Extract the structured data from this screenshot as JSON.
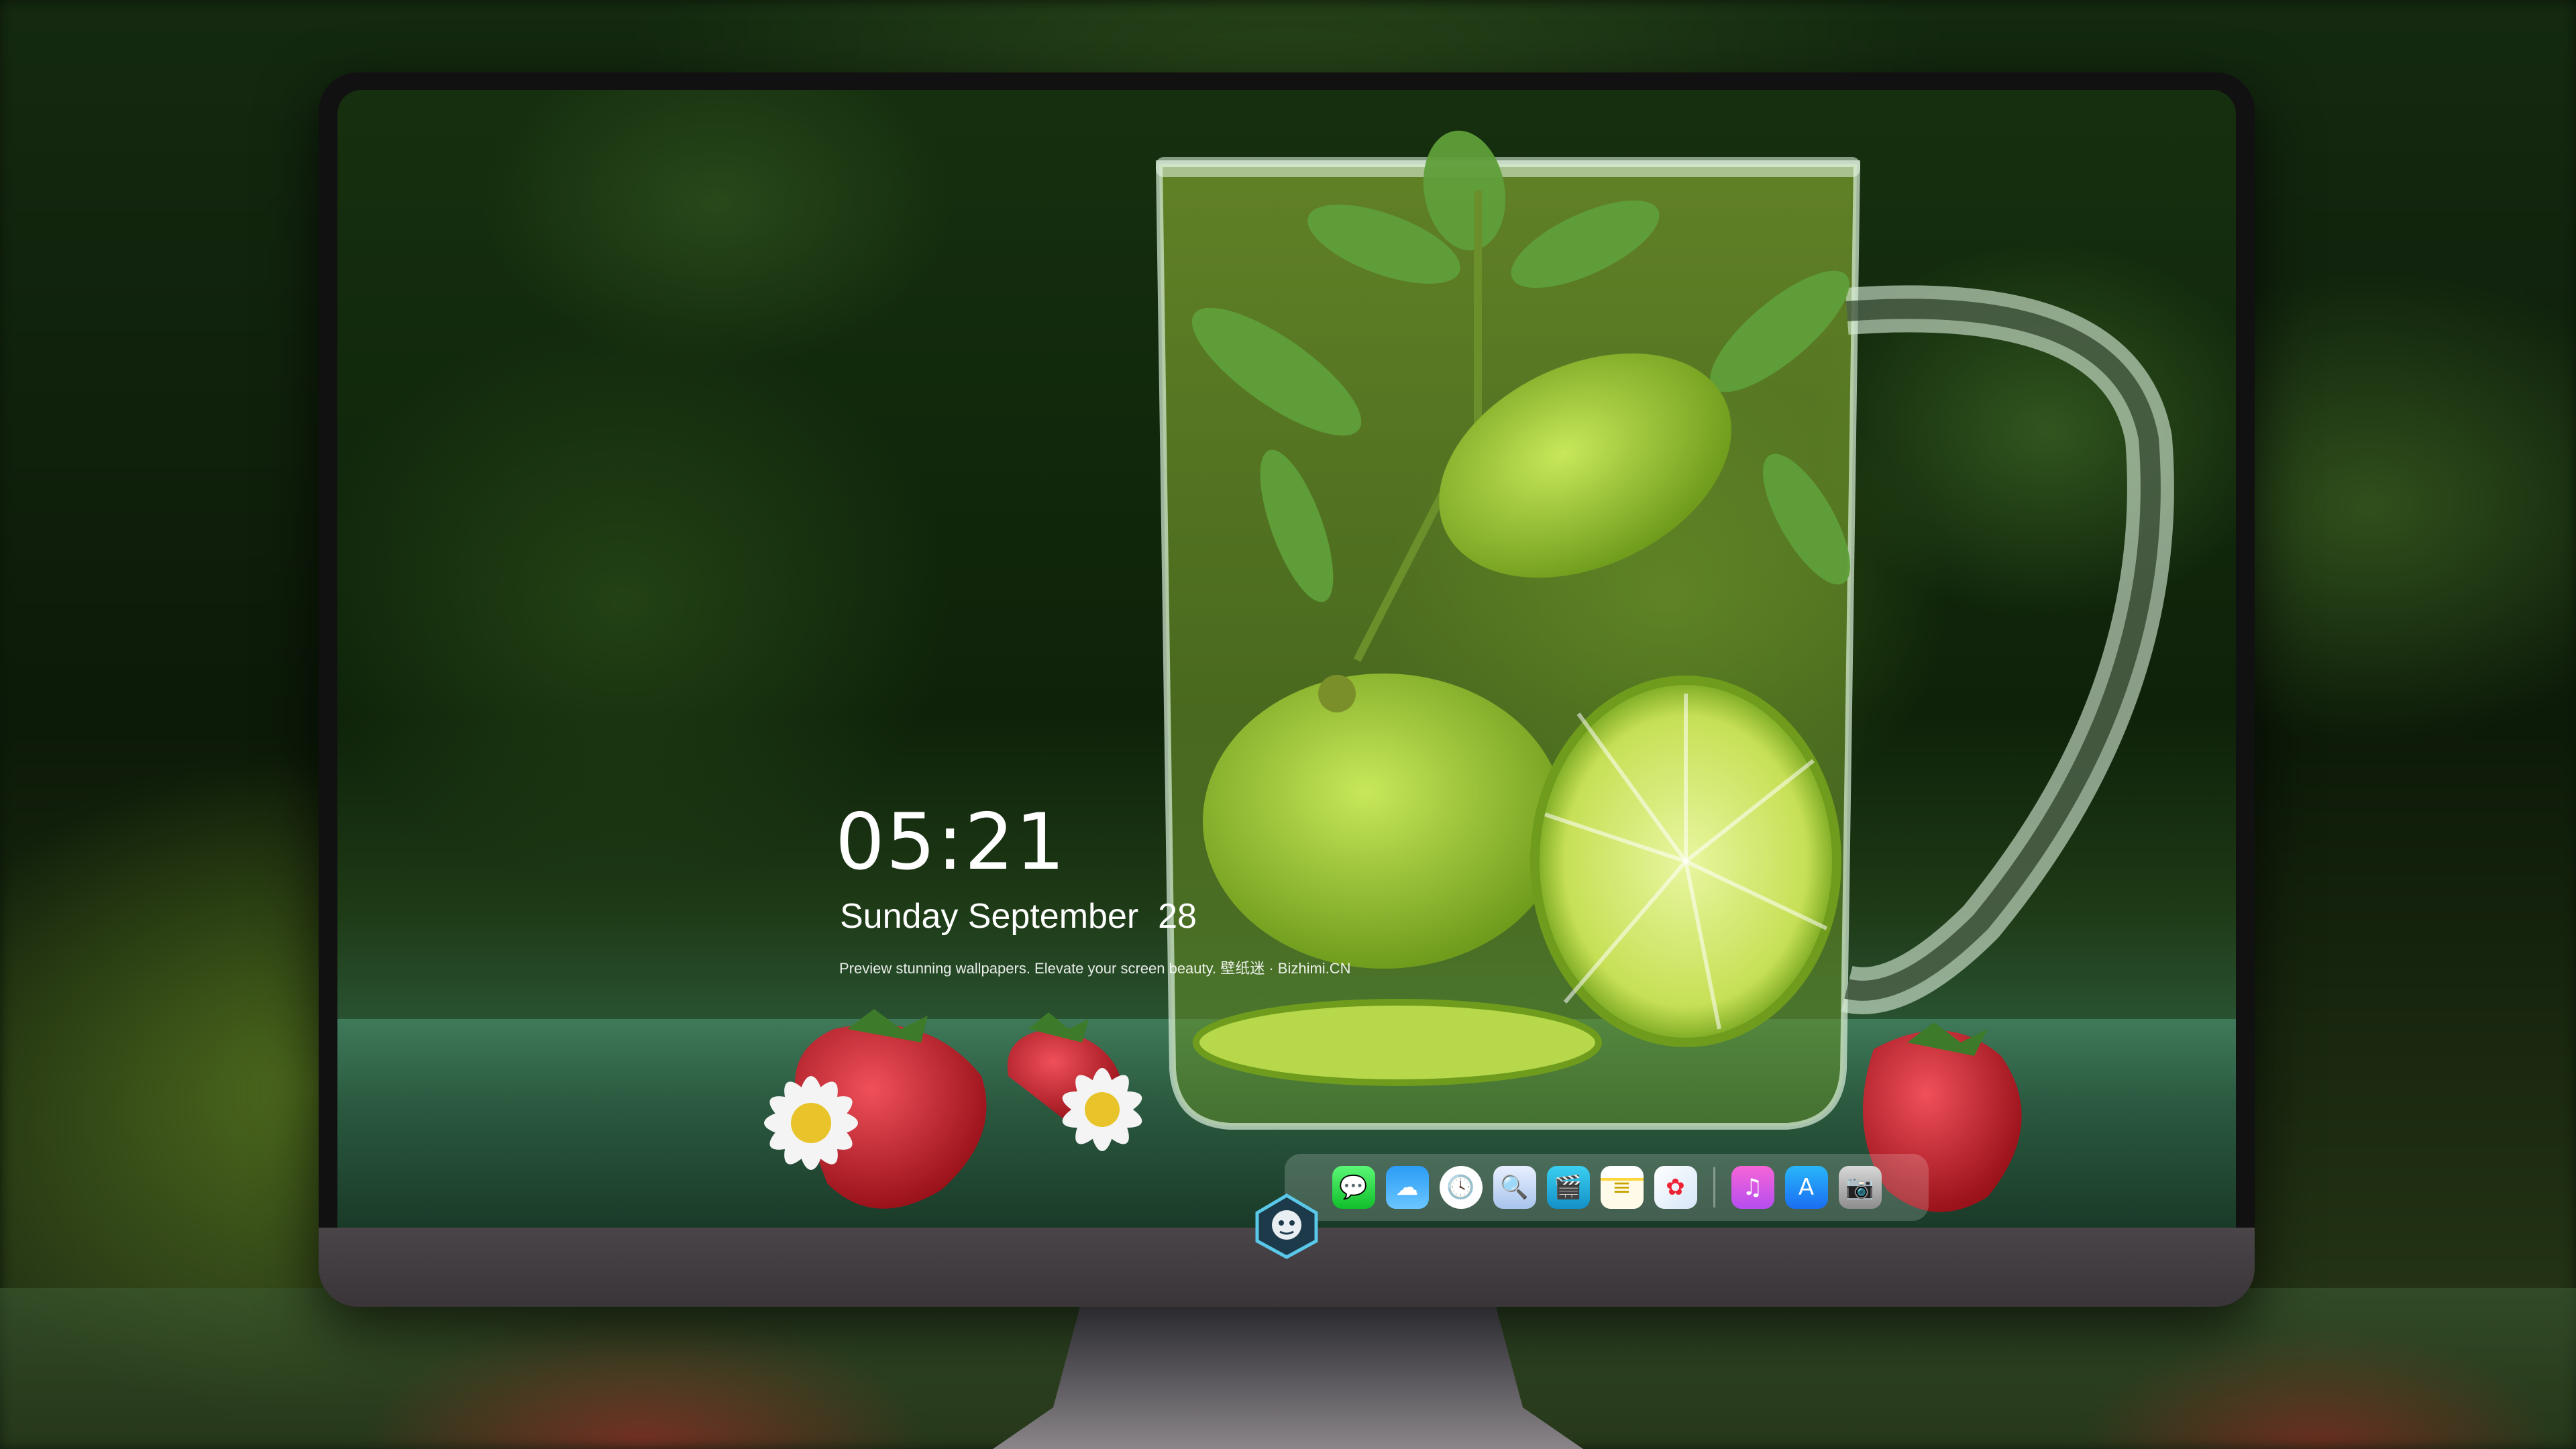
{
  "lock_screen": {
    "time": "05:21",
    "date": "Sunday September  28",
    "tagline": "Preview stunning wallpapers. Elevate your screen beauty. 壁纸迷 · Bizhimi.CN"
  },
  "dock": {
    "items": [
      {
        "name": "messages",
        "glyph": "💬"
      },
      {
        "name": "weather",
        "glyph": "☁"
      },
      {
        "name": "clock",
        "glyph": "🕓"
      },
      {
        "name": "preview",
        "glyph": "🔍"
      },
      {
        "name": "video",
        "glyph": "🎬"
      },
      {
        "name": "notes",
        "glyph": "≡"
      },
      {
        "name": "photo-booth",
        "glyph": "✿"
      },
      {
        "name": "music",
        "glyph": "♫"
      },
      {
        "name": "app-store",
        "glyph": "A"
      },
      {
        "name": "camera",
        "glyph": "📷"
      }
    ]
  },
  "colors": {
    "wallpaper_green": "#16300f",
    "lime": "#9ccc2e",
    "strawberry": "#c8202a",
    "monitor_chin": "#3f3a3d"
  }
}
